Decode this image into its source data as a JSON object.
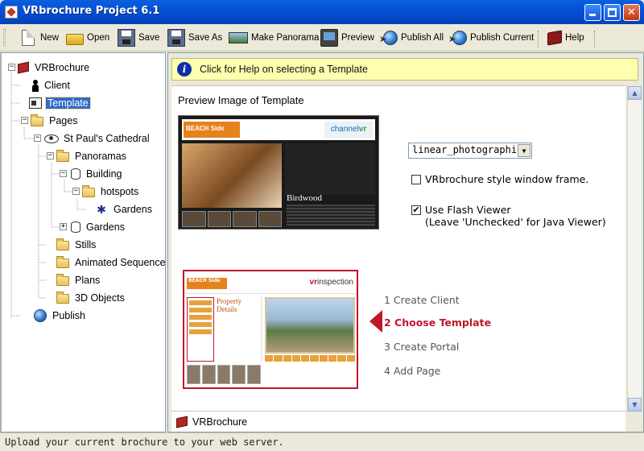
{
  "window": {
    "title": "VRbrochure Project 6.1",
    "min_glyph": "",
    "close_glyph": "✕"
  },
  "toolbar": {
    "new": "New",
    "open": "Open",
    "save": "Save",
    "save_as": "Save As",
    "make_panorama": "Make Panorama",
    "preview": "Preview",
    "publish_all": "Publish All",
    "publish_current": "Publish Current",
    "help": "Help"
  },
  "tree": {
    "root": "VRBrochure",
    "client": "Client",
    "template": "Template",
    "pages": "Pages",
    "page_st_pauls": "St Paul's Cathedral",
    "panoramas": "Panoramas",
    "building": "Building",
    "hotspots": "hotspots",
    "hotspot_gardens": "Gardens",
    "gardens": "Gardens",
    "stills": "Stills",
    "animated_sequence": "Animated Sequence",
    "plans": "Plans",
    "objects_3d": "3D Objects",
    "publish": "Publish",
    "expand_minus": "−",
    "expand_plus": "+"
  },
  "help_banner": "Click for Help on selecting a Template",
  "section_title": "Preview Image of Template",
  "preview_image": {
    "logo": "BEACH Side",
    "brand_main": "channel",
    "brand_accent": "vr",
    "title": "Birdwood"
  },
  "template_select": {
    "value": "linear_photographic",
    "arrow": "▼"
  },
  "options": {
    "window_frame": {
      "label": "VRbrochure style window frame.",
      "checked": false,
      "mark": ""
    },
    "flash_viewer": {
      "label": "Use Flash Viewer",
      "note": "(Leave 'Unchecked' for Java Viewer)",
      "checked": true,
      "mark": "✔"
    }
  },
  "wizard_image": {
    "logo": "BEACH Side",
    "brand_main": "vr",
    "brand_accent": "inspection",
    "title": "Property Details"
  },
  "steps": [
    {
      "label": "1 Create Client",
      "active": false
    },
    {
      "label": "2 Choose Template",
      "active": true
    },
    {
      "label": "3 Create Portal",
      "active": false
    },
    {
      "label": "4 Add Page",
      "active": false
    }
  ],
  "footer_label": "VRBrochure",
  "scrollbar": {
    "up": "▲",
    "down": "▼"
  },
  "status_bar": "Upload your current brochure to your web server."
}
